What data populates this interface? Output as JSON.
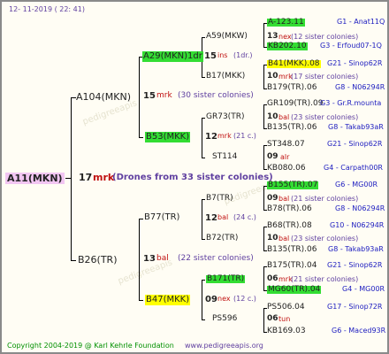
{
  "header": {
    "date": "12- 11-2019 ( 22: 41)"
  },
  "root": {
    "name": "A11(MKN)",
    "year": "17",
    "marking": "mrk",
    "drones_note": "(Drones from 33 sister colonies)"
  },
  "gen2": {
    "upper": {
      "name": "A104(MKN)",
      "year": "15",
      "marking": "mrk",
      "note": "(30 sister colonies)"
    },
    "lower": {
      "name": "B26(TR)",
      "year": "13",
      "marking": "bal",
      "note": "(22 sister colonies)"
    }
  },
  "gen3": [
    {
      "name": "A29(MKN)1dr",
      "year": "15",
      "marking": "ins",
      "note": "(1dr.)"
    },
    {
      "name": "B53(MKK)",
      "year": "12",
      "marking": "mrk",
      "note": "(21 c.)"
    },
    {
      "name": "B77(TR)",
      "year": "12",
      "marking": "bal",
      "note": "(24 c.)"
    },
    {
      "name": "B47(MKK)",
      "year": "09",
      "marking": "nex",
      "note": "(12 c.)"
    }
  ],
  "gen4": [
    {
      "name": "A59(MKW)",
      "year": "13",
      "marking": "nex",
      "note": "(12 sister colonies)"
    },
    {
      "name": "B17(MKK)",
      "year": "10",
      "marking": "mrk",
      "note": "(17 sister colonies)"
    },
    {
      "name": "GR73(TR)",
      "year": "10",
      "marking": "bal",
      "note": "(23 sister colonies)"
    },
    {
      "name": "ST114",
      "year": "09",
      "marking": "alr",
      "note": ""
    },
    {
      "name": "B7(TR)",
      "year": "09",
      "marking": "bal",
      "note": "(21 sister colonies)"
    },
    {
      "name": "B72(TR)",
      "year": "10",
      "marking": "bal",
      "note": "(23 sister colonies)"
    },
    {
      "name": "B171(TR)",
      "year": "06",
      "marking": "mrk",
      "note": "(21 sister colonies)"
    },
    {
      "name": "PS596",
      "year": "06",
      "marking": "tun",
      "note": ""
    }
  ],
  "gen5": [
    {
      "name": "A-123.11",
      "note": "G1 - Anat11Q"
    },
    {
      "name": "KB202.10",
      "note": "G3 - Erfoud07-1Q"
    },
    {
      "name": "B41(MKK).08",
      "note": "G21 - Sinop62R"
    },
    {
      "name": "B179(TR).06",
      "note": "G8 - N06294R"
    },
    {
      "name": "GR109(TR).09",
      "note": "G3 - Gr.R.mounta"
    },
    {
      "name": "B135(TR).06",
      "note": "G8 - Takab93aR"
    },
    {
      "name": "ST348.07",
      "note": "G21 - Sinop62R"
    },
    {
      "name": "KB080.06",
      "note": "G4 - Carpath00R"
    },
    {
      "name": "B155(TR).07",
      "note": "G6 - MG00R"
    },
    {
      "name": "B78(TR).06",
      "note": "G8 - N06294R"
    },
    {
      "name": "B68(TR).08",
      "note": "G10 - N06294R"
    },
    {
      "name": "B135(TR).06",
      "note": "G8 - Takab93aR"
    },
    {
      "name": "B175(TR).04",
      "note": "G21 - Sinop62R"
    },
    {
      "name": "MG60(TR).04",
      "note": "G4 - MG00R"
    },
    {
      "name": "PS506.04",
      "note": "G17 - Sinop72R"
    },
    {
      "name": "KB169.03",
      "note": "G6 - Maced93R"
    }
  ],
  "footer": {
    "copyright": "Copyright 2004-2019 @ Karl Kehrle Foundation",
    "website": "www.pedigreeapis.org"
  },
  "watermark": "pedigreeapis"
}
